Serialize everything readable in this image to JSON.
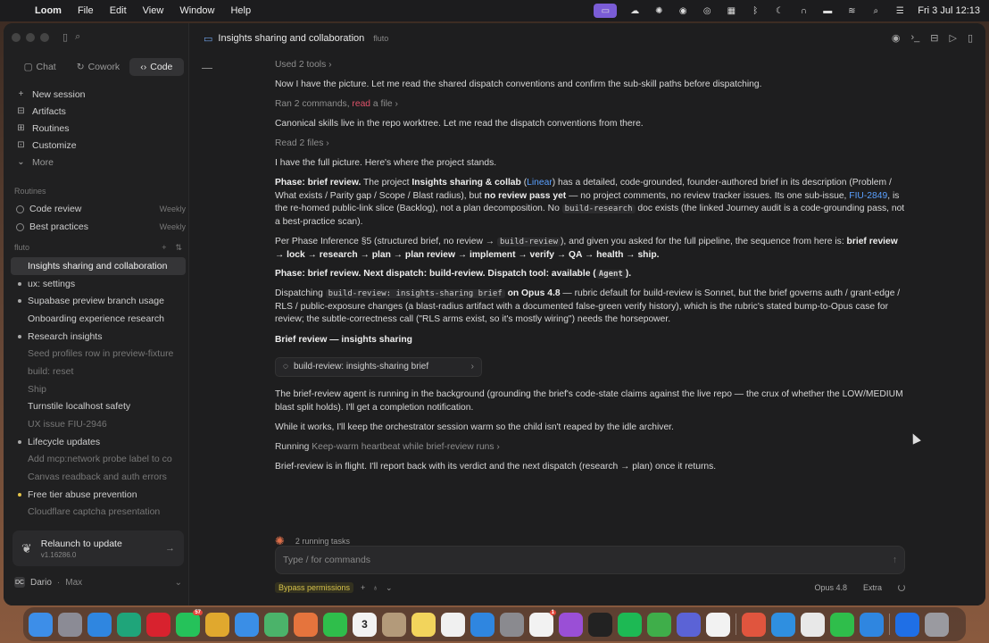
{
  "menubar": {
    "app": "Loom",
    "items": [
      "File",
      "Edit",
      "View",
      "Window",
      "Help"
    ],
    "clock": "Fri 3 Jul  12:13"
  },
  "sidebar": {
    "modes": [
      {
        "label": "Chat",
        "icon": "chat-icon"
      },
      {
        "label": "Cowork",
        "icon": "cowork-icon"
      },
      {
        "label": "Code",
        "icon": "code-icon"
      }
    ],
    "nav": [
      {
        "label": "New session",
        "icon": "plus-icon"
      },
      {
        "label": "Artifacts",
        "icon": "artifacts-icon"
      },
      {
        "label": "Routines",
        "icon": "routines-icon"
      },
      {
        "label": "Customize",
        "icon": "customize-icon"
      },
      {
        "label": "More",
        "icon": "more-icon"
      }
    ],
    "routines_label": "Routines",
    "routines": [
      {
        "name": "Code review",
        "freq": "Weekly"
      },
      {
        "name": "Best practices",
        "freq": "Weekly"
      }
    ],
    "project_label": "fluto",
    "sessions": [
      {
        "label": "Insights sharing and collaboration",
        "dot": "none",
        "state": "active"
      },
      {
        "label": "ux: settings",
        "dot": "grey",
        "state": "normal"
      },
      {
        "label": "Supabase preview branch usage",
        "dot": "grey",
        "state": "normal"
      },
      {
        "label": "Onboarding experience research",
        "dot": "none",
        "state": "normal"
      },
      {
        "label": "Research insights",
        "dot": "grey",
        "state": "normal"
      },
      {
        "label": "Seed profiles row in preview-fixture",
        "dot": "none",
        "state": "dim"
      },
      {
        "label": "build: reset",
        "dot": "none",
        "state": "dim"
      },
      {
        "label": "Ship",
        "dot": "none",
        "state": "dim"
      },
      {
        "label": "Turnstile localhost safety",
        "dot": "none",
        "state": "normal"
      },
      {
        "label": "UX issue FIU-2946",
        "dot": "none",
        "state": "dim"
      },
      {
        "label": "Lifecycle updates",
        "dot": "grey",
        "state": "normal"
      },
      {
        "label": "Add mcp:network probe label to co",
        "dot": "none",
        "state": "dim"
      },
      {
        "label": "Canvas readback and auth errors",
        "dot": "none",
        "state": "dim"
      },
      {
        "label": "Free tier abuse prevention",
        "dot": "yellow",
        "state": "normal"
      },
      {
        "label": "Cloudflare captcha presentation",
        "dot": "none",
        "state": "dim"
      }
    ],
    "update": {
      "title": "Relaunch to update",
      "version": "v1.16286.0"
    },
    "user": {
      "name": "Dario",
      "plan": "Max",
      "initials": "DC"
    }
  },
  "header": {
    "title": "Insights sharing and collaboration",
    "project": "fluto"
  },
  "transcript": {
    "used_tools": "Used 2 tools",
    "p1": "Now I have the picture. Let me read the shared dispatch conventions and confirm the sub-skill paths before dispatching.",
    "ran_prefix": "Ran 2 commands, ",
    "ran_read": "read",
    "ran_suffix": " a file",
    "p2": "Canonical skills live in the repo worktree. Let me read the dispatch conventions from there.",
    "read_files": "Read 2 files",
    "p3": "I have the full picture. Here's where the project stands.",
    "p4_bold": "Phase: brief review.",
    "p4_a": " The project ",
    "p4_project": "Insights sharing & collab",
    "p4_b": " (",
    "p4_linear": "Linear",
    "p4_c": ") has a detailed, code-grounded, founder-authored brief in its description (Problem / What exists / Parity gap / Scope / Blast radius), but ",
    "p4_noreview": "no review pass yet",
    "p4_d": " — no project comments, no review tracker issues. Its one sub-issue, ",
    "p4_issue": "FIU-2849",
    "p4_e": ", is the re-homed public-link slice (Backlog), not a plan decomposition. No ",
    "p4_code": "build-research",
    "p4_f": " doc exists (the linked Journey audit is a code-grounding pass, not a best-practice scan).",
    "p5_a": "Per Phase Inference §5 (structured brief, no review → ",
    "p5_code": "build-review",
    "p5_b": "), and given you asked for the full pipeline, the sequence from here is: ",
    "p5_seq": "brief review → lock → research → plan → plan review → implement → verify → QA → health → ship.",
    "p6_a": "Phase: brief review. Next dispatch: build-review. Dispatch tool: available (",
    "p6_code": "Agent",
    "p6_b": ").",
    "p7_a": "Dispatching ",
    "p7_code": "build-review: insights-sharing brief",
    "p7_b": " on Opus 4.8",
    "p7_c": " — rubric default for build-review is Sonnet, but the brief governs auth / grant-edge / RLS / public-exposure changes (a blast-radius artifact with a documented false-green verify history), which is the rubric's stated bump-to-Opus case for review; the subtle-correctness call (\"RLS arms exist, so it's mostly wiring\") needs the horsepower.",
    "p8": "Brief review — insights sharing",
    "agent_card": "build-review: insights-sharing brief",
    "p9": "The brief-review agent is running in the background (grounding the brief's code-state claims against the live repo — the crux of whether the LOW/MEDIUM blast split holds). I'll get a completion notification.",
    "p10": "While it works, I'll keep the orchestrator session warm so the child isn't reaped by the idle archiver.",
    "running_label": "Running",
    "running_text": "Keep-warm heartbeat while brief-review runs",
    "p11": "Brief-review is in flight. I'll report back with its verdict and the next dispatch (research → plan) once it returns.",
    "tasks": "2 running tasks"
  },
  "composer": {
    "placeholder": "Type / for commands",
    "bypass": "Bypass permissions",
    "model": "Opus 4.8",
    "effort": "Extra"
  },
  "dock": [
    {
      "name": "finder",
      "color": "#3d8ee8"
    },
    {
      "name": "launchpad",
      "color": "#8b8b95"
    },
    {
      "name": "safari",
      "color": "#2f86e0"
    },
    {
      "name": "edge",
      "color": "#1fa57a"
    },
    {
      "name": "opera",
      "color": "#d8222e"
    },
    {
      "name": "whatsapp",
      "color": "#25c25a",
      "badge": "57"
    },
    {
      "name": "chrome",
      "color": "#e0a82e"
    },
    {
      "name": "mail",
      "color": "#3a8ee6"
    },
    {
      "name": "maps",
      "color": "#4bb36a"
    },
    {
      "name": "photos",
      "color": "#e5743d"
    },
    {
      "name": "facetime",
      "color": "#2fbe4b"
    },
    {
      "name": "calendar",
      "color": "#f2f2f2",
      "label": "3"
    },
    {
      "name": "contacts",
      "color": "#b39a7a"
    },
    {
      "name": "notes",
      "color": "#f2d45c"
    },
    {
      "name": "freeform",
      "color": "#f0f0f0"
    },
    {
      "name": "app-store",
      "color": "#2f86e0"
    },
    {
      "name": "settings",
      "color": "#8a8a8f"
    },
    {
      "name": "reminders",
      "color": "#f2f2f2",
      "badge": "1"
    },
    {
      "name": "podcasts",
      "color": "#9a4fd6"
    },
    {
      "name": "figma",
      "color": "#222222"
    },
    {
      "name": "spotify",
      "color": "#1db954"
    },
    {
      "name": "numbers",
      "color": "#3fae4a"
    },
    {
      "name": "linear",
      "color": "#5b63d6"
    },
    {
      "name": "slack",
      "color": "#f2f2f2"
    },
    {
      "name": "loom",
      "color": "#e0553e"
    },
    {
      "name": "docker",
      "color": "#2f8fe0"
    },
    {
      "name": "textedit",
      "color": "#e8e8e8"
    },
    {
      "name": "terminal-green",
      "color": "#2fbe4b"
    },
    {
      "name": "vpn",
      "color": "#2f86e0"
    },
    {
      "name": "1password",
      "color": "#1f6fe6"
    },
    {
      "name": "trash",
      "color": "#9a9aa0"
    }
  ]
}
